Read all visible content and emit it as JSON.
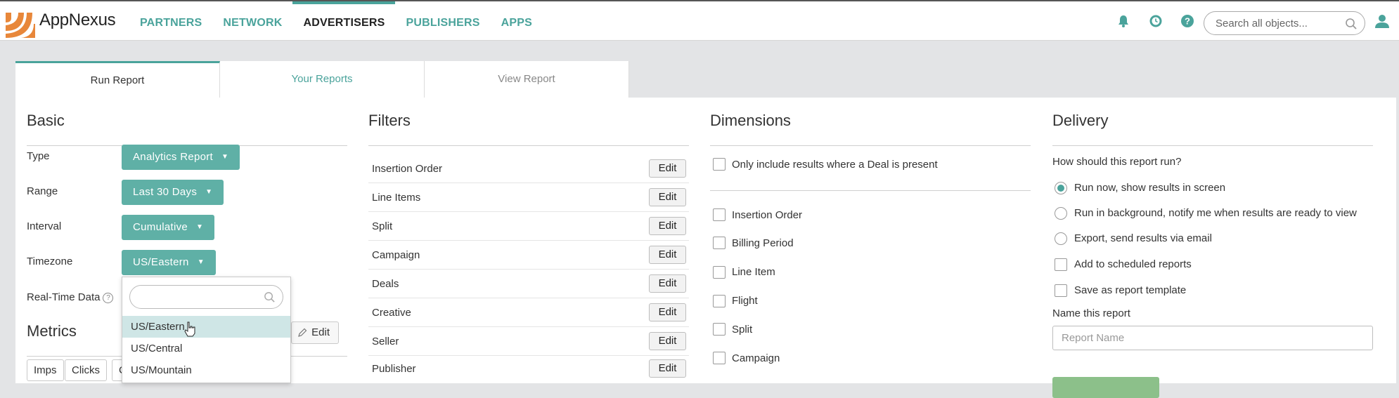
{
  "app": {
    "brand": "AppNexus",
    "colors": {
      "accent": "#4aa39b",
      "dropdown": "#5fb0a6",
      "logo_orange": "#e8873a"
    }
  },
  "nav": {
    "items": [
      {
        "label": "PARTNERS",
        "active": false
      },
      {
        "label": "NETWORK",
        "active": false
      },
      {
        "label": "ADVERTISERS",
        "active": true
      },
      {
        "label": "PUBLISHERS",
        "active": false
      },
      {
        "label": "APPS",
        "active": false
      }
    ]
  },
  "header_icons": [
    "bell-icon",
    "clock-icon",
    "help-icon",
    "user-icon"
  ],
  "search": {
    "placeholder": "Search all objects..."
  },
  "tabs": [
    "Run Report",
    "Your Reports",
    "View Report"
  ],
  "basic": {
    "title": "Basic",
    "type_label": "Type",
    "type_value": "Analytics Report",
    "range_label": "Range",
    "range_value": "Last 30 Days",
    "interval_label": "Interval",
    "interval_value": "Cumulative",
    "timezone_label": "Timezone",
    "timezone_value": "US/Eastern",
    "realtime_label": "Real-Time Data",
    "timezone_options": [
      "US/Eastern",
      "US/Central",
      "US/Mountain"
    ]
  },
  "metrics": {
    "title": "Metrics",
    "edit_label": "Edit",
    "chips": [
      "Imps",
      "Clicks",
      "C"
    ]
  },
  "filters": {
    "title": "Filters",
    "edit_label": "Edit",
    "items": [
      "Insertion Order",
      "Line Items",
      "Split",
      "Campaign",
      "Deals",
      "Creative",
      "Seller",
      "Publisher"
    ]
  },
  "dimensions": {
    "title": "Dimensions",
    "deal_only": "Only include results where a Deal is present",
    "items": [
      "Insertion Order",
      "Billing Period",
      "Line Item",
      "Flight",
      "Split",
      "Campaign"
    ]
  },
  "delivery": {
    "title": "Delivery",
    "question": "How should this report run?",
    "options": [
      "Run now, show results in screen",
      "Run in background, notify me when results are ready to view",
      "Export, send results via email"
    ],
    "checkboxes": [
      "Add to scheduled reports",
      "Save as report template"
    ],
    "name_label": "Name this report",
    "name_placeholder": "Report Name"
  }
}
